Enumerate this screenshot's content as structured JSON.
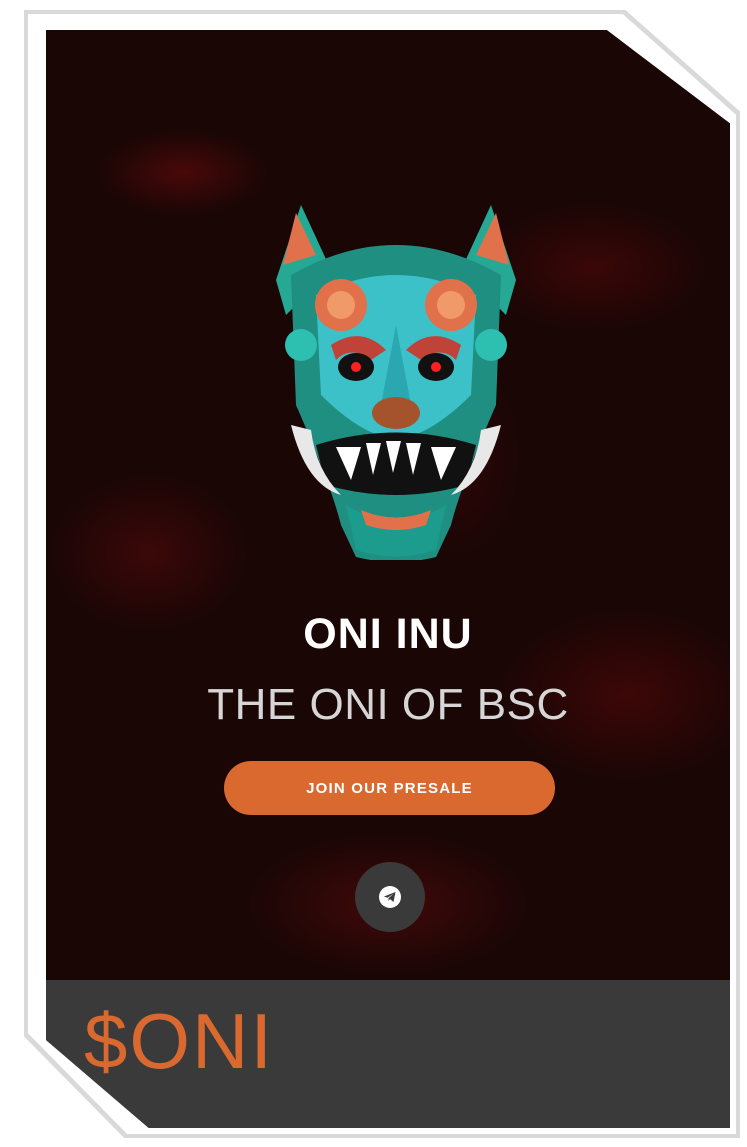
{
  "hero": {
    "title": "ONI INU",
    "subtitle": "THE ONI OF BSC",
    "cta_label": "JOIN OUR PRESALE",
    "mask_icon": "oni-mask-icon",
    "social_icon": "telegram-icon"
  },
  "footer": {
    "ticker": "$ONI"
  },
  "colors": {
    "accent": "#d9692f",
    "background": "#1b0606",
    "footer": "#3a3a3a"
  }
}
